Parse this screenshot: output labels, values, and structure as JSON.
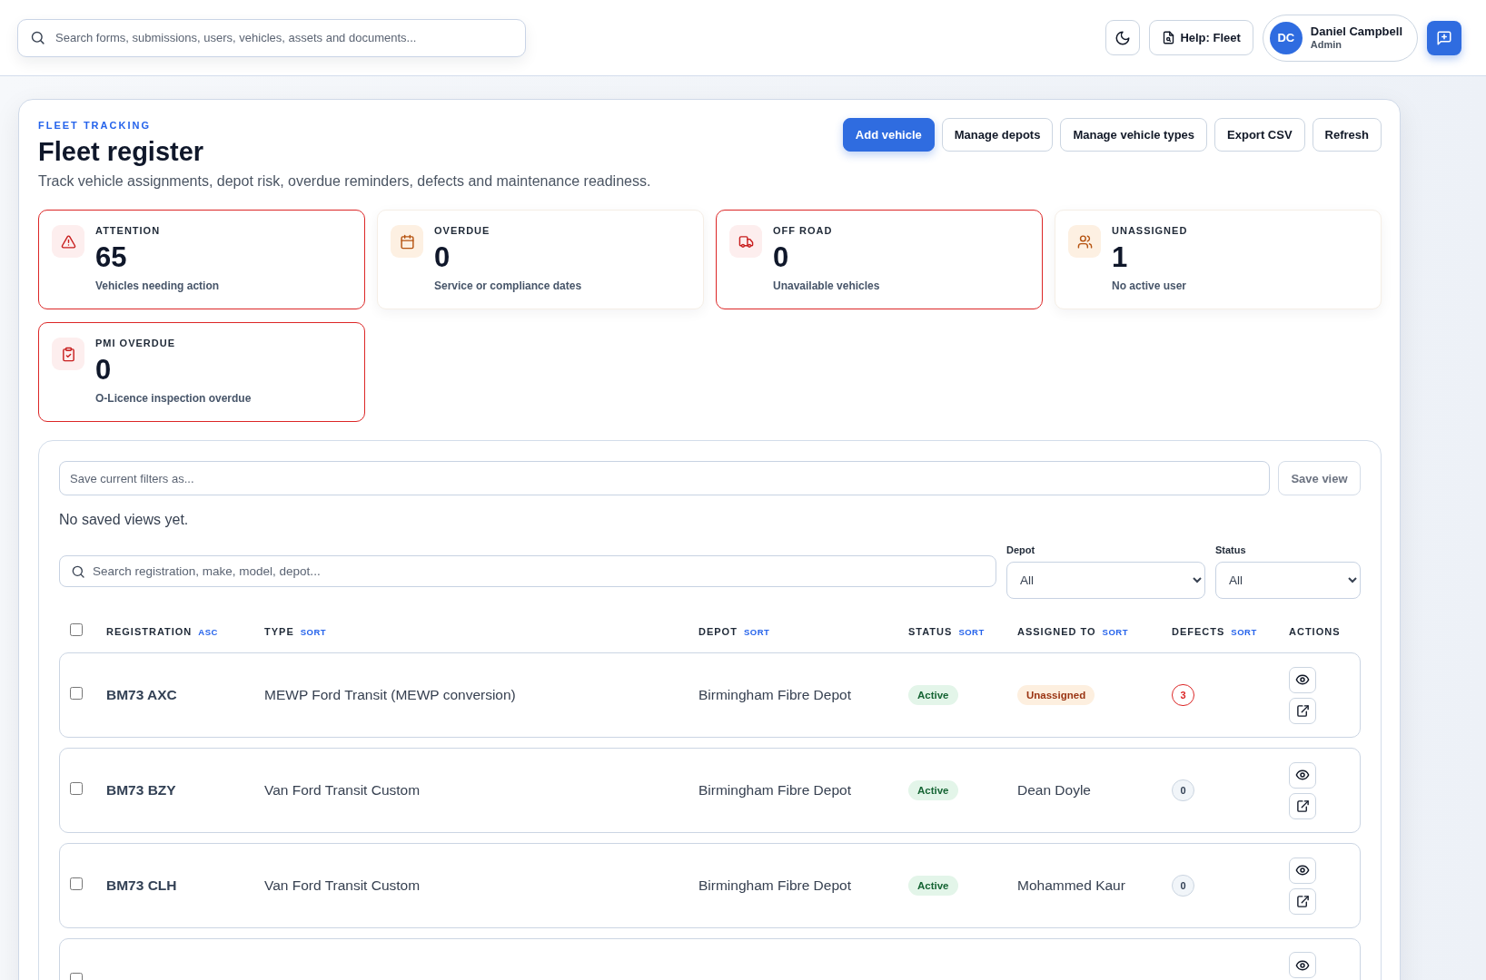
{
  "topbar": {
    "search": {
      "placeholder": "Search forms, submissions, users, vehicles, assets and documents..."
    },
    "help_button": "Help: Fleet",
    "user": {
      "initials": "DC",
      "name": "Daniel Campbell",
      "role": "Admin"
    }
  },
  "header": {
    "eyebrow": "FLEET TRACKING",
    "title": "Fleet register",
    "subtitle": "Track vehicle assignments, depot risk, overdue reminders, defects and maintenance readiness.",
    "actions": [
      {
        "label": "Add vehicle",
        "kind": "primary"
      },
      {
        "label": "Manage depots",
        "kind": "secondary"
      },
      {
        "label": "Manage vehicle types",
        "kind": "secondary"
      },
      {
        "label": "Export CSV",
        "kind": "secondary"
      },
      {
        "label": "Refresh",
        "kind": "secondary"
      }
    ]
  },
  "stats": [
    {
      "label": "ATTENTION",
      "value": "65",
      "description": "Vehicles needing action",
      "alert": true
    },
    {
      "label": "OVERDUE",
      "value": "0",
      "description": "Service or compliance dates",
      "alert": false
    },
    {
      "label": "OFF ROAD",
      "value": "0",
      "description": "Unavailable vehicles",
      "alert": true
    },
    {
      "label": "UNASSIGNED",
      "value": "1",
      "description": "No active user",
      "alert": false
    },
    {
      "label": "PMI OVERDUE",
      "value": "0",
      "description": "O-Licence inspection overdue",
      "alert": true
    }
  ],
  "saved_views": {
    "name_field": {
      "placeholder": "Save current filters as..."
    },
    "save_button": {
      "label": "Save view",
      "disabled": true
    },
    "empty_message": "No saved views yet."
  },
  "filters": {
    "search": {
      "placeholder": "Search registration, make, model, depot..."
    },
    "selects": [
      {
        "label": "Depot",
        "value": "All"
      },
      {
        "label": "Status",
        "value": "All"
      }
    ]
  },
  "table": {
    "select_all": {
      "checked": false
    },
    "columns": [
      {
        "label": "REGISTRATION",
        "sort": "ASC"
      },
      {
        "label": "TYPE",
        "sort": "SORT"
      },
      {
        "label": "DEPOT",
        "sort": "SORT"
      },
      {
        "label": "STATUS",
        "sort": "SORT"
      },
      {
        "label": "ASSIGNED TO",
        "sort": "SORT"
      },
      {
        "label": "DEFECTS",
        "sort": "SORT"
      },
      {
        "label": "ACTIONS"
      }
    ],
    "rows": [
      {
        "checked": false,
        "registration": "BM73 AXC",
        "type": "MEWP Ford Transit (MEWP conversion)",
        "depot": "Birmingham Fibre Depot",
        "status": {
          "label": "Active",
          "kind": "active"
        },
        "assigned_to": {
          "name": "Unassigned",
          "kind": "unassigned"
        },
        "defects": {
          "count": "3",
          "kind": "alert"
        }
      },
      {
        "checked": false,
        "registration": "BM73 BZY",
        "type": "Van Ford Transit Custom",
        "depot": "Birmingham Fibre Depot",
        "status": {
          "label": "Active",
          "kind": "active"
        },
        "assigned_to": {
          "name": "Dean Doyle",
          "kind": "user"
        },
        "defects": {
          "count": "0",
          "kind": "none"
        }
      },
      {
        "checked": false,
        "registration": "BM73 CLH",
        "type": "Van Ford Transit Custom",
        "depot": "Birmingham Fibre Depot",
        "status": {
          "label": "Active",
          "kind": "active"
        },
        "assigned_to": {
          "name": "Mohammed Kaur",
          "kind": "user"
        },
        "defects": {
          "count": "0",
          "kind": "none"
        }
      },
      {
        "checked": false
      }
    ]
  }
}
